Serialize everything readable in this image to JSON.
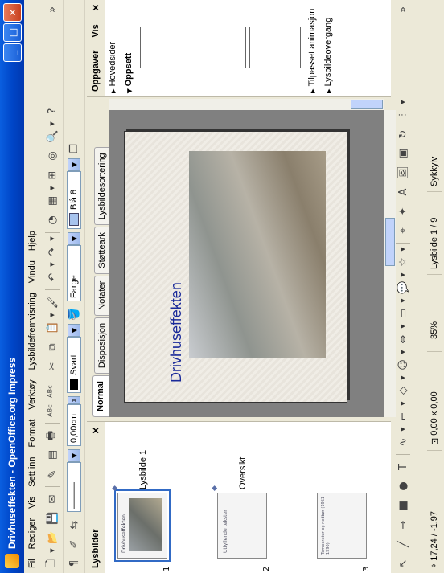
{
  "window": {
    "title": "Drivhuseffekten - OpenOffice.org Impress"
  },
  "menu": [
    "Fil",
    "Rediger",
    "Vis",
    "Sett inn",
    "Format",
    "Verktøy",
    "Lysbildefremvisning",
    "Vindu",
    "Hjelp"
  ],
  "line_toolbar": {
    "line_width": "0,00cm",
    "line_color": "Svart",
    "area_style": "Farge",
    "area_color": "Blå 8"
  },
  "slides_pane": {
    "title": "Lysbilder",
    "slides": [
      {
        "number": "1",
        "label": "Lysbilde 1",
        "thumb_title": "Drivhuseffekten"
      },
      {
        "number": "2",
        "label": "Oversikt",
        "thumb_title": "Utfyllende tekster"
      },
      {
        "number": "3",
        "label": "",
        "thumb_title": "Temperatur og nedbør (1961-1990)"
      }
    ]
  },
  "view_tabs": [
    "Normal",
    "Disposisjon",
    "Notater",
    "Støtteark",
    "Lysbildesortering"
  ],
  "slide": {
    "title": "Drivhuseffekten"
  },
  "tasks_pane": {
    "title": "Oppgaver",
    "view_label": "Vis",
    "sections": [
      "Hovedsider",
      "Oppsett",
      "Tilpasset animasjon",
      "Lysbildeovergang"
    ]
  },
  "status": {
    "position": "17,24 / -1,97",
    "size": "0,00 x 0,00",
    "zoom": "35%",
    "slide_counter": "Lysbilde 1 / 9",
    "style": "Sykkylv"
  },
  "colors": {
    "titlebar": "#0046c8",
    "slide_title": "#1a2a9a",
    "selection": "#316ac5"
  }
}
